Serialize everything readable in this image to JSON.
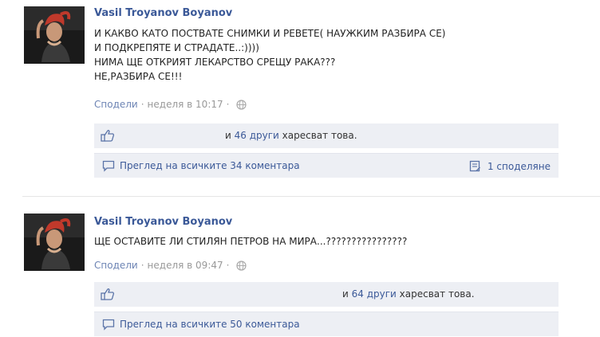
{
  "posts": [
    {
      "author": "Vasil Troyanov Boyanov",
      "message_lines": [
        "И КАКВО КАТО ПОСТВАТЕ СНИМКИ И РЕВЕТЕ( НАУЖКИМ РАЗБИРА СЕ)",
        "И ПОДКРЕПЯТЕ И СТРАДАТЕ..:))))",
        "НИМА ЩЕ ОТКРИЯТ ЛЕКАРСТВО СРЕЩУ РАКА???",
        "НЕ,РАЗБИРА СЕ!!!"
      ],
      "share_label": "Сподели",
      "separator": "·",
      "timestamp": "неделя в 10:17",
      "separator2": "·",
      "likes_prefix": "и",
      "likes_link": "46 други",
      "likes_suffix": "харесват това.",
      "comments_label": "Преглед на всичките 34 коментара",
      "shares_label": "1 споделяне"
    },
    {
      "author": "Vasil Troyanov Boyanov",
      "message_lines": [
        "ЩЕ ОСТАВИТЕ ЛИ СТИЛЯН ПЕТРОВ НА МИРА...????????????????"
      ],
      "share_label": "Сподели",
      "separator": "·",
      "timestamp": "неделя в 09:47",
      "separator2": "·",
      "likes_prefix": "и",
      "likes_link": "64 други",
      "likes_suffix": "харесват това.",
      "comments_label": "Преглед на всичките 50 коментара"
    }
  ],
  "icons": {
    "avatar": "profile-photo",
    "globe": "globe-icon",
    "like": "thumbs-up-icon",
    "comment": "comment-icon",
    "share": "share-icon"
  },
  "colors": {
    "link": "#3b5998",
    "bar_bg": "#edeff4",
    "meta": "#999999"
  }
}
